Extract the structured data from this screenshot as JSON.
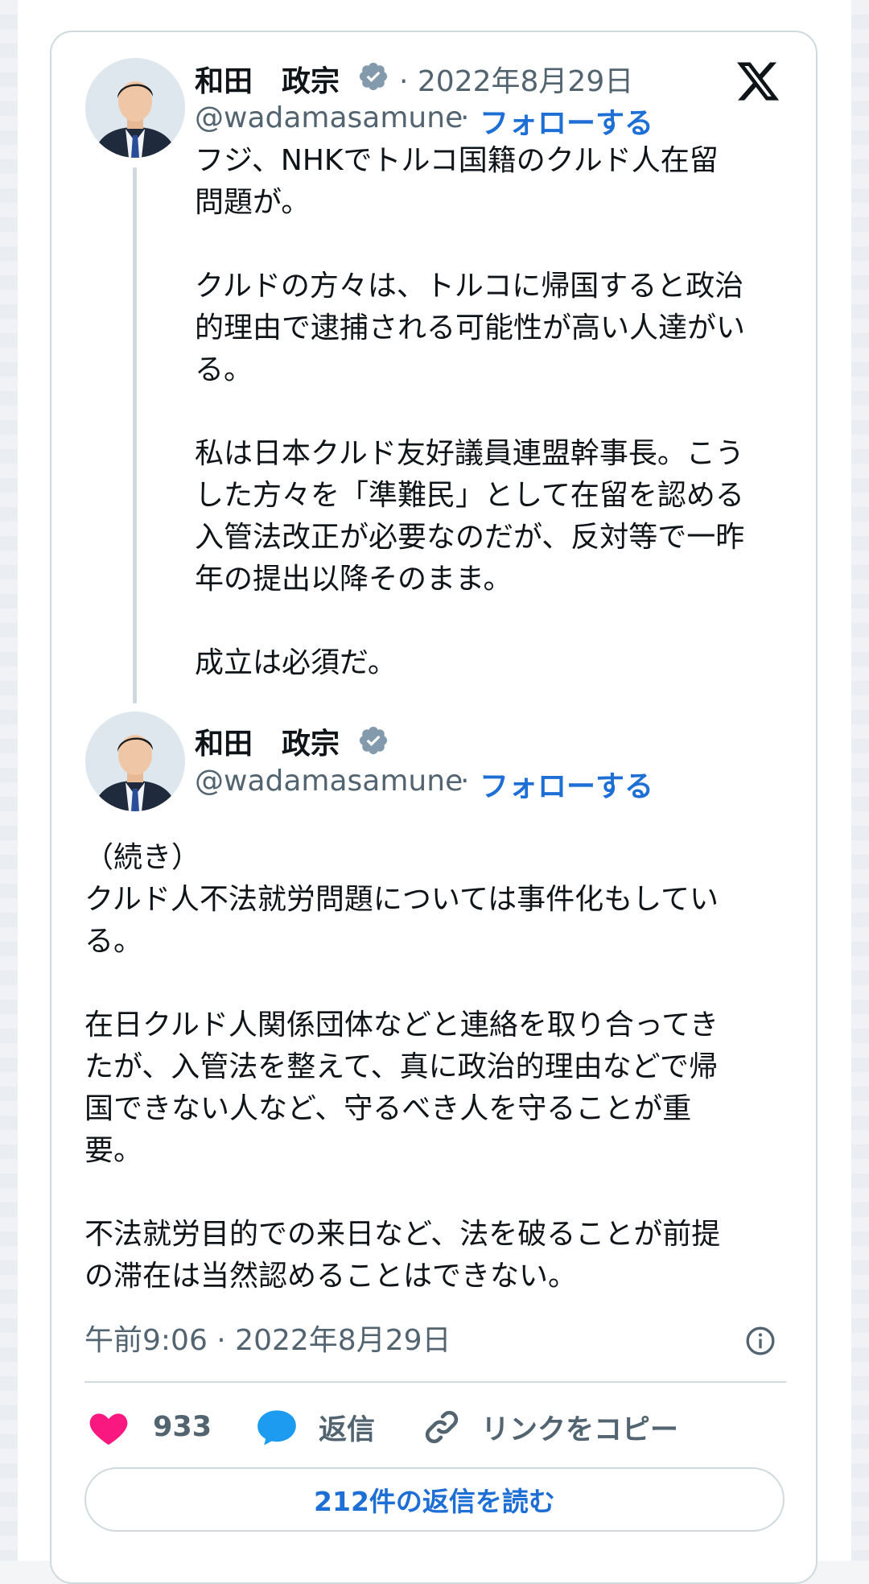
{
  "colors": {
    "link_blue": "#1d6fd6",
    "secondary_text": "#536471",
    "like_pink": "#f91880",
    "reply_blue": "#1d9bf0",
    "border": "#cfd9de"
  },
  "brand": {
    "icon": "x-logo-icon"
  },
  "tweet1": {
    "author_name": "和田　政宗",
    "verified_icon": "verified-badge-icon",
    "separator_date": "· 2022年8月29日",
    "handle": "@wadamasamune",
    "separator": "·",
    "follow_label": "フォローする",
    "text": "フジ、NHKでトルコ国籍のクルド人在留\n問題が。\n\nクルドの方々は、トルコに帰国すると政治\n的理由で逮捕される可能性が高い人達がい\nる。\n\n私は日本クルド友好議員連盟幹事長。こう\nした方々を「準難民」として在留を認める\n入管法改正が必要なのだが、反対等で一昨\n年の提出以降そのまま。\n\n成立は必須だ。"
  },
  "tweet2": {
    "author_name": "和田　政宗",
    "verified_icon": "verified-badge-icon",
    "handle": "@wadamasamune",
    "separator": "·",
    "follow_label": "フォローする",
    "text": "（続き）\nクルド人不法就労問題については事件化もしてい\nる。\n\n在日クルド人関係団体などと連絡を取り合ってき\nたが、入管法を整えて、真に政治的理由などで帰\n国できない人など、守るべき人を守ることが重\n要。\n\n不法就労目的での来日など、法を破ることが前提\nの滞在は当然認めることはできない。",
    "timestamp": "午前9:06 · 2022年8月29日"
  },
  "actions": {
    "like_count": "933",
    "reply_label": "返信",
    "copy_link_label": "リンクをコピー",
    "read_replies_label": "212件の返信を読む"
  }
}
